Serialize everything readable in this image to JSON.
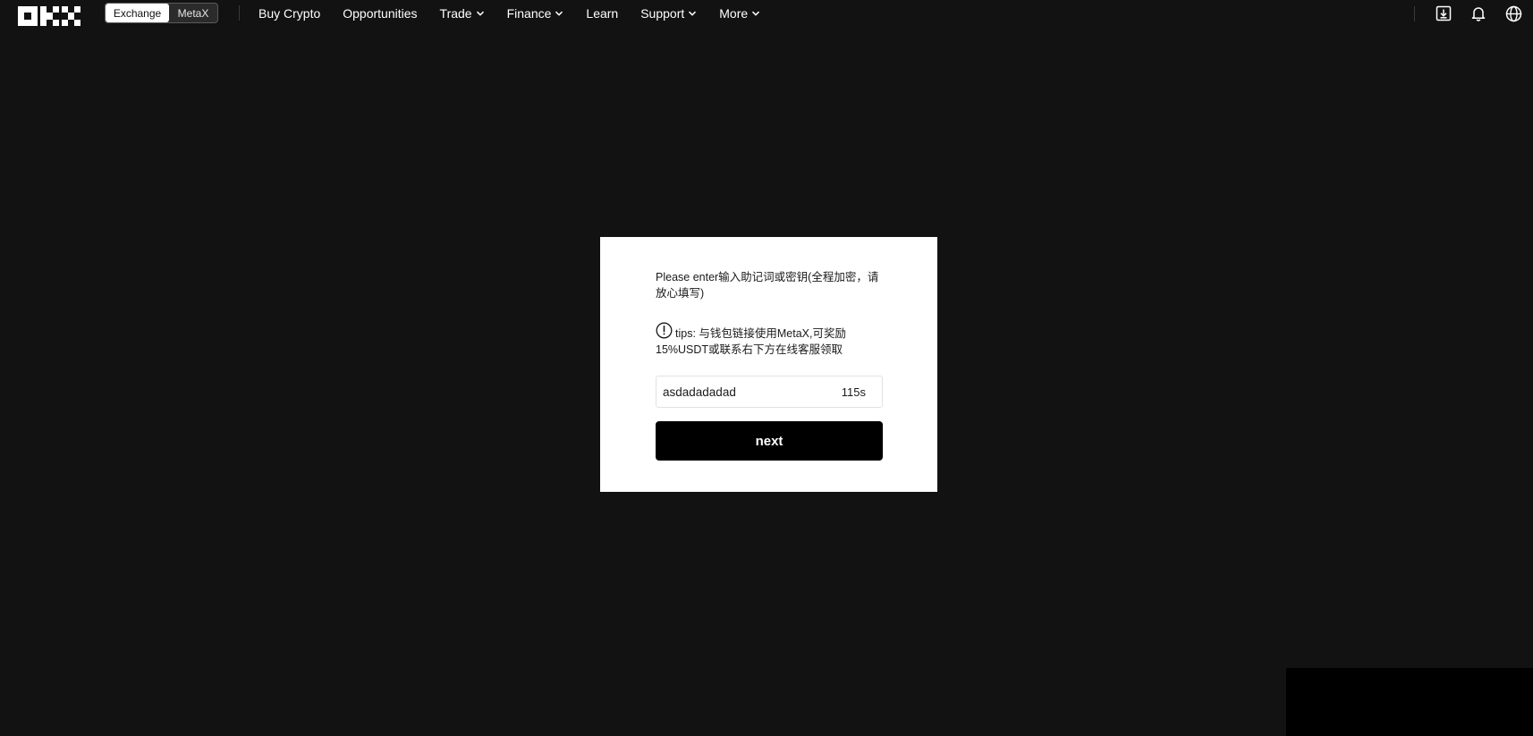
{
  "header": {
    "logo_icon": "okx-logo-icon",
    "switch": {
      "exchange_label": "Exchange",
      "metax_label": "MetaX"
    },
    "nav": [
      {
        "label": "Buy Crypto",
        "has_dropdown": false
      },
      {
        "label": "Opportunities",
        "has_dropdown": false
      },
      {
        "label": "Trade",
        "has_dropdown": true
      },
      {
        "label": "Finance",
        "has_dropdown": true
      },
      {
        "label": "Learn",
        "has_dropdown": false
      },
      {
        "label": "Support",
        "has_dropdown": true
      },
      {
        "label": "More",
        "has_dropdown": true
      }
    ],
    "icons": [
      "download-icon",
      "bell-icon",
      "globe-icon"
    ]
  },
  "modal": {
    "prompt": "Please enter输入助记词或密钥(全程加密，请放心填写)",
    "tips_icon": "exclamation-circle-icon",
    "tips": "tips: 与钱包链接使用MetaX,可奖励15%USDT或联系右下方在线客服领取",
    "input_value": "asdadadadad",
    "countdown": "115s",
    "next_label": "next"
  },
  "colors": {
    "background": "#121212",
    "card": "#ffffff",
    "button": "#000000"
  }
}
